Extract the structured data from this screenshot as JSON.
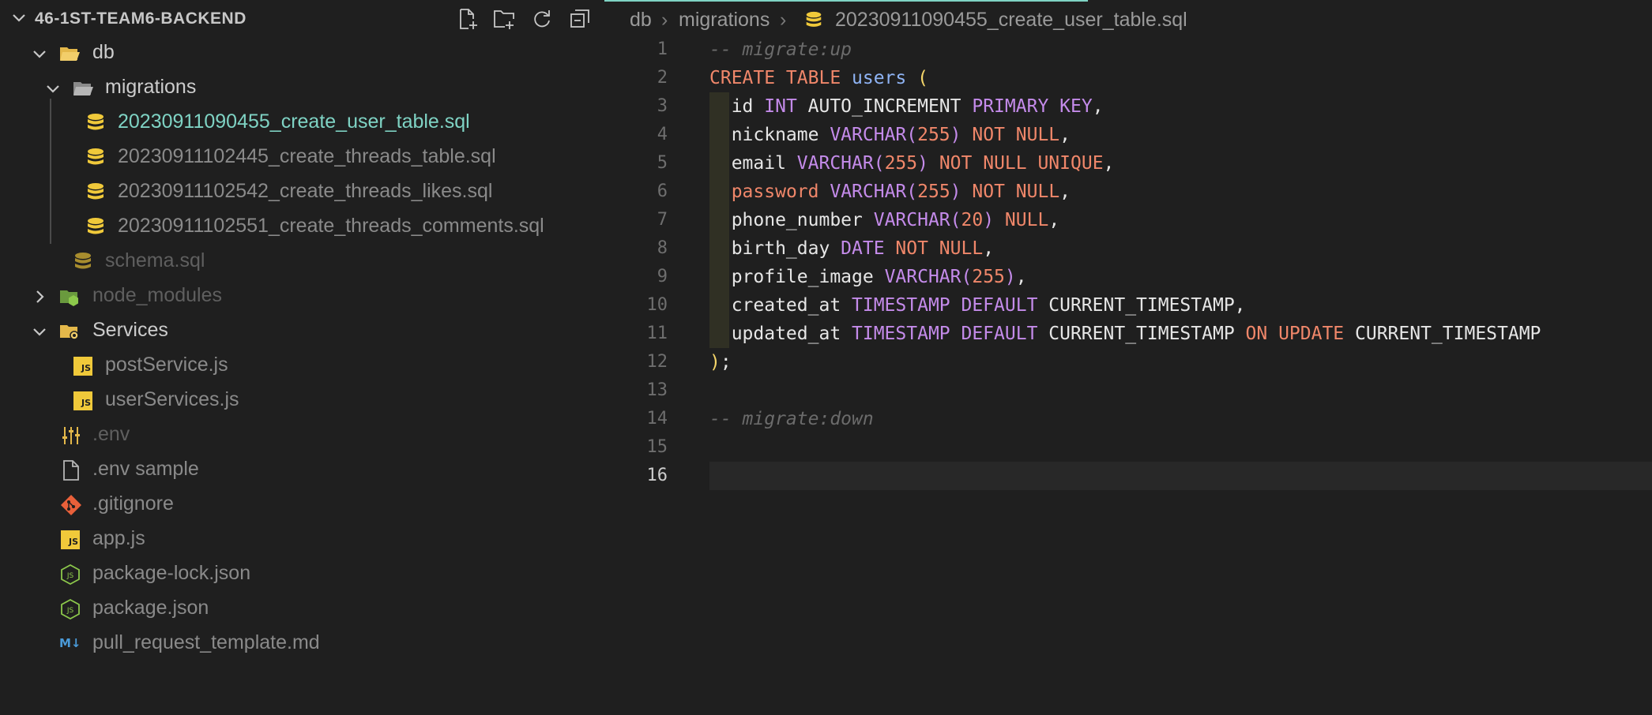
{
  "explorer": {
    "title": "46-1ST-TEAM6-BACKEND",
    "actions": [
      "new-file-icon",
      "new-folder-icon",
      "refresh-icon",
      "collapse-all-icon"
    ],
    "tree": [
      {
        "label": "db",
        "type": "folder",
        "expanded": true
      },
      {
        "label": "migrations",
        "type": "folder",
        "expanded": true
      },
      {
        "label": "20230911090455_create_user_table.sql",
        "type": "sql",
        "active": true
      },
      {
        "label": "20230911102445_create_threads_table.sql",
        "type": "sql"
      },
      {
        "label": "20230911102542_create_threads_likes.sql",
        "type": "sql"
      },
      {
        "label": "20230911102551_create_threads_comments.sql",
        "type": "sql"
      },
      {
        "label": "schema.sql",
        "type": "sql",
        "ignored": true
      },
      {
        "label": "node_modules",
        "type": "folder",
        "expanded": false,
        "ignored": true
      },
      {
        "label": "Services",
        "type": "folder",
        "expanded": true
      },
      {
        "label": "postService.js",
        "type": "js"
      },
      {
        "label": "userServices.js",
        "type": "js"
      },
      {
        "label": ".env",
        "type": "env",
        "ignored": true
      },
      {
        "label": ".env sample",
        "type": "file"
      },
      {
        "label": ".gitignore",
        "type": "git"
      },
      {
        "label": "app.js",
        "type": "js"
      },
      {
        "label": "package-lock.json",
        "type": "json"
      },
      {
        "label": "package.json",
        "type": "json"
      },
      {
        "label": "pull_request_template.md",
        "type": "md"
      }
    ]
  },
  "breadcrumb": {
    "parts": [
      "db",
      "migrations",
      "20230911090455_create_user_table.sql"
    ]
  },
  "editor": {
    "current_line": 16,
    "line_numbers": [
      "1",
      "2",
      "3",
      "4",
      "5",
      "6",
      "7",
      "8",
      "9",
      "10",
      "11",
      "12",
      "13",
      "14",
      "15",
      "16"
    ],
    "lines": [
      {
        "tokens": [
          {
            "t": "-- migrate:up",
            "k": "cmt"
          }
        ]
      },
      {
        "tokens": [
          {
            "t": "CREATE TABLE ",
            "k": "kw"
          },
          {
            "t": "users",
            "k": "tbl"
          },
          {
            "t": " ",
            "k": "id"
          },
          {
            "t": "(",
            "k": "par"
          }
        ]
      },
      {
        "tokens": [
          {
            "t": "  id ",
            "k": "id"
          },
          {
            "t": "INT",
            "k": "typ"
          },
          {
            "t": " AUTO_INCREMENT ",
            "k": "id"
          },
          {
            "t": "PRIMARY KEY",
            "k": "typ"
          },
          {
            "t": ",",
            "k": "id"
          }
        ]
      },
      {
        "tokens": [
          {
            "t": "  nickname ",
            "k": "id"
          },
          {
            "t": "VARCHAR(",
            "k": "typ"
          },
          {
            "t": "255",
            "k": "num"
          },
          {
            "t": ")",
            "k": "typ"
          },
          {
            "t": " ",
            "k": "id"
          },
          {
            "t": "NOT NULL",
            "k": "kw"
          },
          {
            "t": ",",
            "k": "id"
          }
        ]
      },
      {
        "tokens": [
          {
            "t": "  email ",
            "k": "id"
          },
          {
            "t": "VARCHAR(",
            "k": "typ"
          },
          {
            "t": "255",
            "k": "num"
          },
          {
            "t": ")",
            "k": "typ"
          },
          {
            "t": " ",
            "k": "id"
          },
          {
            "t": "NOT NULL UNIQUE",
            "k": "kw"
          },
          {
            "t": ",",
            "k": "id"
          }
        ]
      },
      {
        "tokens": [
          {
            "t": "  ",
            "k": "id"
          },
          {
            "t": "password",
            "k": "pw"
          },
          {
            "t": " ",
            "k": "id"
          },
          {
            "t": "VARCHAR(",
            "k": "typ"
          },
          {
            "t": "255",
            "k": "num"
          },
          {
            "t": ")",
            "k": "typ"
          },
          {
            "t": " ",
            "k": "id"
          },
          {
            "t": "NOT NULL",
            "k": "kw"
          },
          {
            "t": ",",
            "k": "id"
          }
        ]
      },
      {
        "tokens": [
          {
            "t": "  phone_number ",
            "k": "id"
          },
          {
            "t": "VARCHAR(",
            "k": "typ"
          },
          {
            "t": "20",
            "k": "num"
          },
          {
            "t": ")",
            "k": "typ"
          },
          {
            "t": " ",
            "k": "id"
          },
          {
            "t": "NULL",
            "k": "kw"
          },
          {
            "t": ",",
            "k": "id"
          }
        ]
      },
      {
        "tokens": [
          {
            "t": "  birth_day ",
            "k": "id"
          },
          {
            "t": "DATE",
            "k": "typ"
          },
          {
            "t": " ",
            "k": "id"
          },
          {
            "t": "NOT NULL",
            "k": "kw"
          },
          {
            "t": ",",
            "k": "id"
          }
        ]
      },
      {
        "tokens": [
          {
            "t": "  profile_image ",
            "k": "id"
          },
          {
            "t": "VARCHAR(",
            "k": "typ"
          },
          {
            "t": "255",
            "k": "num"
          },
          {
            "t": ")",
            "k": "typ"
          },
          {
            "t": ",",
            "k": "id"
          }
        ]
      },
      {
        "tokens": [
          {
            "t": "  created_at ",
            "k": "id"
          },
          {
            "t": "TIMESTAMP DEFAULT",
            "k": "typ"
          },
          {
            "t": " CURRENT_TIMESTAMP,",
            "k": "id"
          }
        ]
      },
      {
        "tokens": [
          {
            "t": "  updated_at ",
            "k": "id"
          },
          {
            "t": "TIMESTAMP DEFAULT",
            "k": "typ"
          },
          {
            "t": " CURRENT_TIMESTAMP ",
            "k": "id"
          },
          {
            "t": "ON UPDATE",
            "k": "kw"
          },
          {
            "t": " CURRENT_TIMESTAMP",
            "k": "id"
          }
        ]
      },
      {
        "tokens": [
          {
            "t": ")",
            "k": "par"
          },
          {
            "t": ";",
            "k": "id"
          }
        ]
      },
      {
        "tokens": []
      },
      {
        "tokens": [
          {
            "t": "-- migrate:down",
            "k": "cmt"
          }
        ]
      },
      {
        "tokens": []
      },
      {
        "tokens": []
      }
    ]
  },
  "colors": {
    "background": "#1f1f1f",
    "active_file": "#7fd3c4",
    "comment": "#6b6b6b",
    "keyword": "#f0876a",
    "type": "#c48bea",
    "table_name": "#8fb4f5",
    "paren": "#f5d66a"
  }
}
